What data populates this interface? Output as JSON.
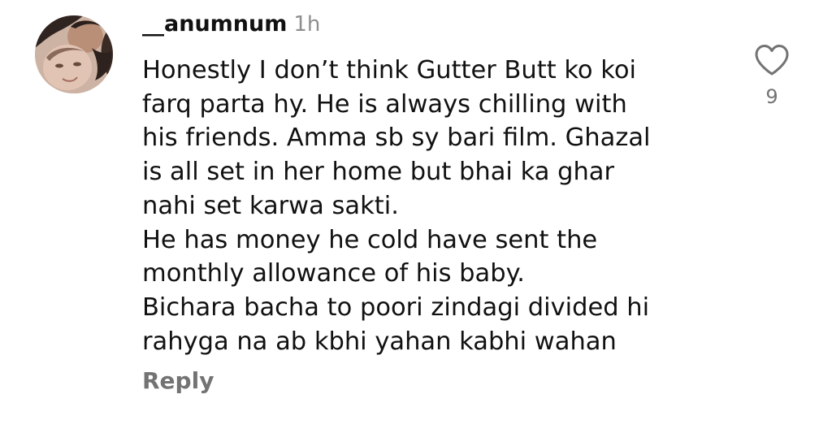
{
  "comment": {
    "username": "__anumnum",
    "timestamp": "1h",
    "text_lines": [
      "Honestly I don’t think Gutter Butt ko koi",
      "farq parta hy. He is always chilling with",
      "his friends. Amma sb sy bari film. Ghazal",
      "is all set in her home but bhai ka ghar",
      "nahi set karwa sakti.",
      "He has money he cold have sent the",
      "monthly allowance of his baby.",
      "Bichara bacha to poori zindagi divided hi",
      "rahyga na ab kbhi yahan kabhi wahan"
    ],
    "reply_label": "Reply",
    "like_count": "9",
    "avatar_icon": "profile-photo",
    "like_icon": "heart-outline-icon"
  },
  "colors": {
    "text": "#111111",
    "muted": "#737373",
    "timestamp": "#8e8e8e",
    "background": "#ffffff"
  }
}
